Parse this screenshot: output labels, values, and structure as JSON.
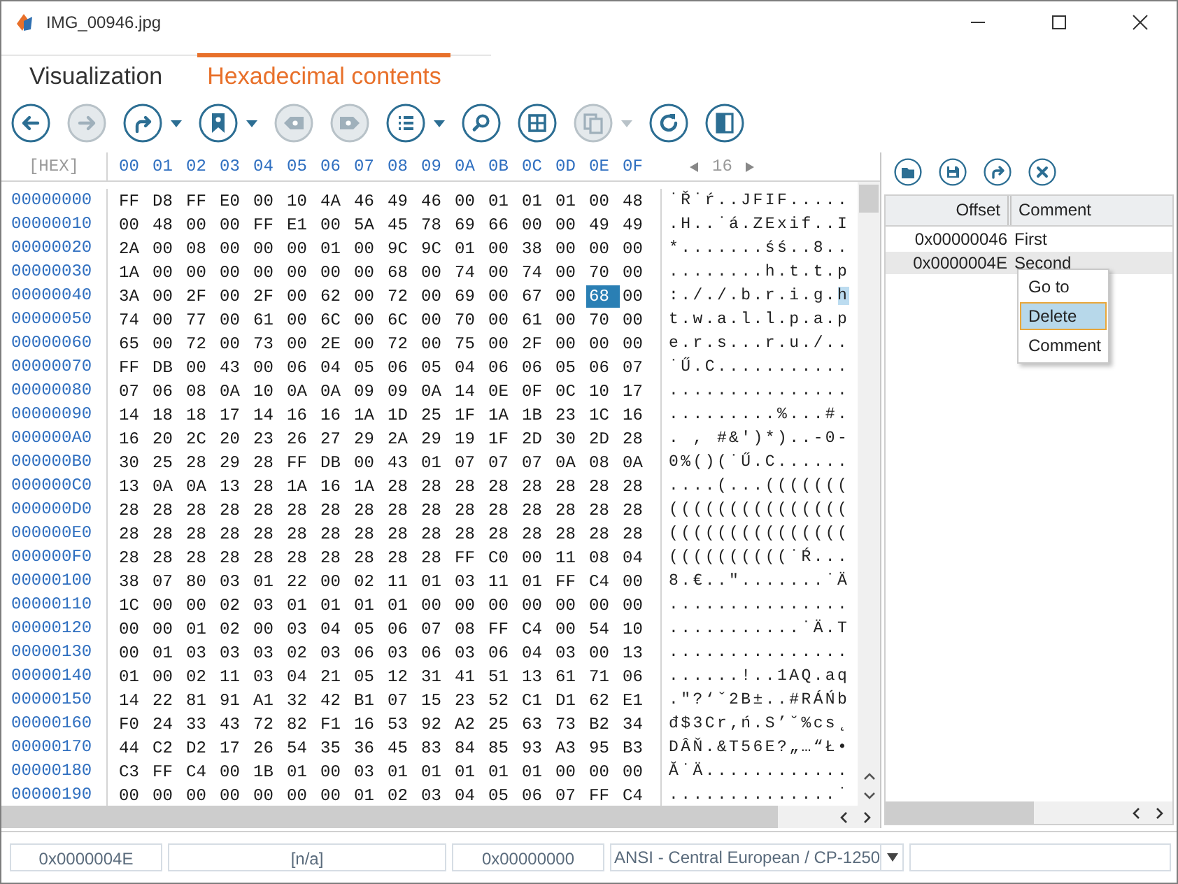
{
  "window": {
    "title": "IMG_00946.jpg"
  },
  "tabs": [
    {
      "label": "Visualization",
      "selected": false
    },
    {
      "label": "Hexadecimal contents",
      "selected": true
    }
  ],
  "toolbar": [
    {
      "kind": "back",
      "disabled": false,
      "dropdown": false
    },
    {
      "kind": "forward",
      "disabled": true,
      "dropdown": false
    },
    {
      "kind": "jump",
      "disabled": false,
      "dropdown": true
    },
    {
      "kind": "bookmark",
      "disabled": false,
      "dropdown": true
    },
    {
      "kind": "previous-bookmark",
      "disabled": true,
      "dropdown": false
    },
    {
      "kind": "next-bookmark",
      "disabled": true,
      "dropdown": false
    },
    {
      "kind": "list",
      "disabled": false,
      "dropdown": true
    },
    {
      "kind": "search",
      "disabled": false,
      "dropdown": false
    },
    {
      "kind": "grid",
      "disabled": false,
      "dropdown": false
    },
    {
      "kind": "copy",
      "disabled": true,
      "dropdown": true
    },
    {
      "kind": "refresh",
      "disabled": false,
      "dropdown": false
    },
    {
      "kind": "panel",
      "disabled": false,
      "dropdown": false
    }
  ],
  "hex_view": {
    "corner": "[HEX]",
    "columns": [
      "00",
      "01",
      "02",
      "03",
      "04",
      "05",
      "06",
      "07",
      "08",
      "09",
      "0A",
      "0B",
      "0C",
      "0D",
      "0E",
      "0F"
    ],
    "bytes_per_row": "16",
    "rows": [
      {
        "address": "00000000",
        "bytes": "FF D8 FF E0 00 10 4A 46 49 46 00 01 01 01 00 48",
        "ascii": "˙Ř˙ŕ..JFIF....."
      },
      {
        "address": "00000010",
        "bytes": "00 48 00 00 FF E1 00 5A 45 78 69 66 00 00 49 49",
        "ascii": ".H..˙á.ZExif..I"
      },
      {
        "address": "00000020",
        "bytes": "2A 00 08 00 00 00 01 00 9C 9C 01 00 38 00 00 00",
        "ascii": "*.......śś..8.."
      },
      {
        "address": "00000030",
        "bytes": "1A 00 00 00 00 00 00 00 68 00 74 00 74 00 70 00",
        "ascii": "........h.t.t.p"
      },
      {
        "address": "00000040",
        "bytes": "3A 00 2F 00 2F 00 62 00 72 00 69 00 67 00",
        "cursor_byte": "68",
        "bytes_after": "00",
        "ascii": ":././.b.r.i.g.h"
      },
      {
        "address": "00000050",
        "bytes": "74 00 77 00 61 00 6C 00 6C 00 70 00 61 00 70 00",
        "ascii": "t.w.a.l.l.p.a.p"
      },
      {
        "address": "00000060",
        "bytes": "65 00 72 00 73 00 2E 00 72 00 75 00 2F 00 00 00",
        "ascii": "e.r.s...r.u./.."
      },
      {
        "address": "00000070",
        "bytes": "FF DB 00 43 00 06 04 05 06 05 04 06 06 05 06 07",
        "ascii": "˙Ű.C..........."
      },
      {
        "address": "00000080",
        "bytes": "07 06 08 0A 10 0A 0A 09 09 0A 14 0E 0F 0C 10 17",
        "ascii": "..............."
      },
      {
        "address": "00000090",
        "bytes": "14 18 18 17 14 16 16 1A 1D 25 1F 1A 1B 23 1C 16",
        "ascii": ".........%...#."
      },
      {
        "address": "000000A0",
        "bytes": "16 20 2C 20 23 26 27 29 2A 29 19 1F 2D 30 2D 28",
        "ascii": ". , #&')*)..-0-"
      },
      {
        "address": "000000B0",
        "bytes": "30 25 28 29 28 FF DB 00 43 01 07 07 07 0A 08 0A",
        "ascii": "0%()(˙Ű.C......"
      },
      {
        "address": "000000C0",
        "bytes": "13 0A 0A 13 28 1A 16 1A 28 28 28 28 28 28 28 28",
        "ascii": "....(...((((((("
      },
      {
        "address": "000000D0",
        "bytes": "28 28 28 28 28 28 28 28 28 28 28 28 28 28 28 28",
        "ascii": "((((((((((((((("
      },
      {
        "address": "000000E0",
        "bytes": "28 28 28 28 28 28 28 28 28 28 28 28 28 28 28 28",
        "ascii": "((((((((((((((("
      },
      {
        "address": "000000F0",
        "bytes": "28 28 28 28 28 28 28 28 28 28 FF C0 00 11 08 04",
        "ascii": "((((((((((˙Ŕ..."
      },
      {
        "address": "00000100",
        "bytes": "38 07 80 03 01 22 00 02 11 01 03 11 01 FF C4 00",
        "ascii": "8.€..\".......˙Ä"
      },
      {
        "address": "00000110",
        "bytes": "1C 00 00 02 03 01 01 01 01 00 00 00 00 00 00 00",
        "ascii": "..............."
      },
      {
        "address": "00000120",
        "bytes": "00 00 01 02 00 03 04 05 06 07 08 FF C4 00 54 10",
        "ascii": "...........˙Ä.T"
      },
      {
        "address": "00000130",
        "bytes": "00 01 03 03 03 02 03 06 03 06 03 06 04 03 00 13",
        "ascii": "..............."
      },
      {
        "address": "00000140",
        "bytes": "01 00 02 11 03 04 21 05 12 31 41 51 13 61 71 06",
        "ascii": "......!..1AQ.aq"
      },
      {
        "address": "00000150",
        "bytes": "14 22 81 91 A1 32 42 B1 07 15 23 52 C1 D1 62 E1",
        "ascii": ".\"?‘ˇ2B±..#RÁŃb"
      },
      {
        "address": "00000160",
        "bytes": "F0 24 33 43 72 82 F1 16 53 92 A2 25 63 73 B2 34",
        "ascii": "đ$3Cr‚ń.S’˘%cs˛"
      },
      {
        "address": "00000170",
        "bytes": "44 C2 D2 17 26 54 35 36 45 83 84 85 93 A3 95 B3",
        "ascii": "DÂŇ.&T56E?„…“Ł•"
      },
      {
        "address": "00000180",
        "bytes": "C3 FF C4 00 1B 01 00 03 01 01 01 01 01 00 00 00",
        "ascii": "Ă˙Ä............"
      },
      {
        "address": "00000190",
        "bytes": "00 00 00 00 00 00 00 01 02 03 04 05 06 07 FF C4",
        "ascii": "..............˙"
      }
    ]
  },
  "bookmarks": {
    "toolbar": [
      {
        "kind": "open"
      },
      {
        "kind": "save"
      },
      {
        "kind": "jump"
      },
      {
        "kind": "close"
      }
    ],
    "columns": [
      "Offset",
      "Comment"
    ],
    "rows": [
      {
        "offset": "0x00000046",
        "comment": "First",
        "selected": false
      },
      {
        "offset": "0x0000004E",
        "comment": "Second",
        "selected": true
      }
    ],
    "context_menu": [
      {
        "label": "Go to",
        "selected": false
      },
      {
        "label": "Delete",
        "selected": true
      },
      {
        "label": "Comment",
        "selected": false
      }
    ]
  },
  "status_bar": {
    "fields": [
      "0x0000004E",
      "[n/a]",
      "0x00000000"
    ],
    "encoding": "ANSI - Central European / CP-1250"
  }
}
